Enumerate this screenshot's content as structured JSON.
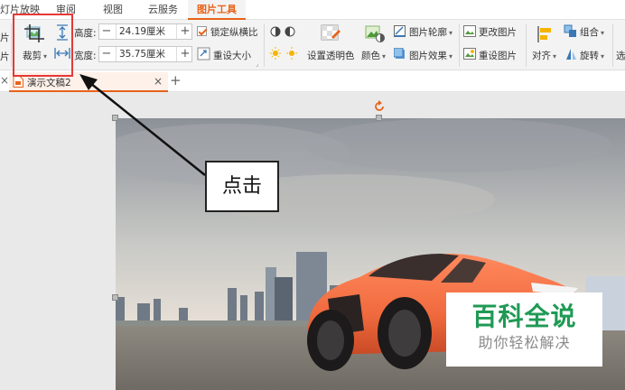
{
  "menu": {
    "tabs": [
      "灯片放映",
      "审阅",
      "视图",
      "云服务",
      "图片工具"
    ],
    "active_tab": "图片工具"
  },
  "ribbon": {
    "crop_label": "裁剪",
    "height_label": "高度:",
    "height_value": "24.19厘米",
    "width_label": "宽度:",
    "width_value": "35.75厘米",
    "lock_ratio_label": "锁定纵横比",
    "reset_size_label": "重设大小",
    "transparent_label": "设置透明色",
    "color_label": "颜色",
    "outline_label": "图片轮廓",
    "effects_label": "图片效果",
    "change_label": "更改图片",
    "reset_label": "重设图片",
    "align_label": "对齐",
    "group_label": "组合",
    "rotate_label": "旋转",
    "select_label_partial": "选",
    "left_partial_top": "片",
    "left_partial_bottom": "片"
  },
  "document": {
    "tab_title": "演示文稿2",
    "close_symbol": "×",
    "new_tab_symbol": "+",
    "left_close_symbol": "×"
  },
  "annotation": {
    "callout_text": "点击"
  },
  "watermark": {
    "title": "百科全说",
    "subtitle": "助你轻松解决"
  },
  "colors": {
    "accent": "#e8631a",
    "annotation_red": "#e53935",
    "watermark_green": "#1f9a55",
    "car": "#f06a3e"
  }
}
